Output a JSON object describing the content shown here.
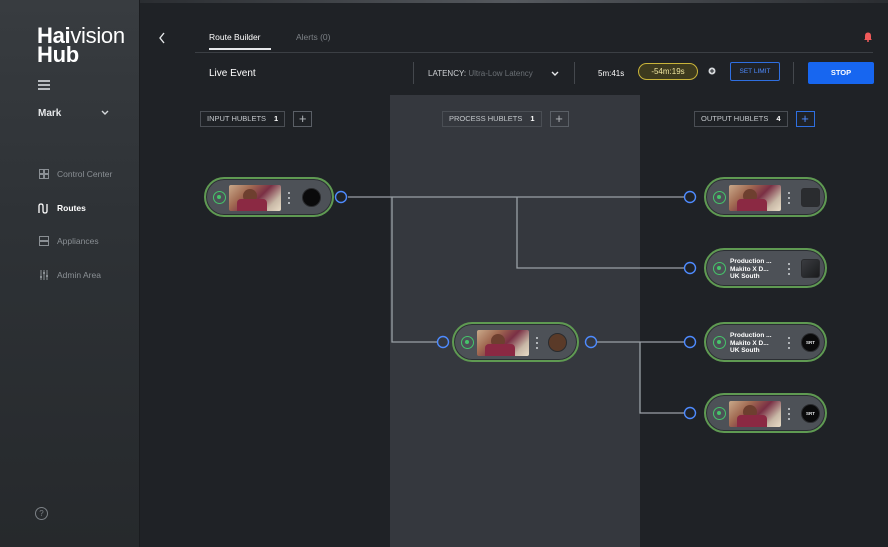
{
  "brand": {
    "line1_bold": "Hai",
    "line1_rest": "vision",
    "line2": "Hub"
  },
  "sidebar": {
    "user": "Mark",
    "items": [
      {
        "label": "Control Center",
        "icon": "grid-icon",
        "active": false
      },
      {
        "label": "Routes",
        "icon": "route-icon",
        "active": true
      },
      {
        "label": "Appliances",
        "icon": "appliance-icon",
        "active": false
      },
      {
        "label": "Admin Area",
        "icon": "sliders-icon",
        "active": false
      }
    ],
    "help": "?"
  },
  "header": {
    "tabs": [
      {
        "label": "Route Builder",
        "active": true
      },
      {
        "label": "Alerts (0)",
        "active": false
      }
    ],
    "event_name": "Live Event",
    "latency_label": "LATENCY:",
    "latency_value": "Ultra-Low Latency",
    "elapsed": "5m:41s",
    "remaining": "-54m:19s",
    "set_limit": "SET LIMIT",
    "stop": "STOP"
  },
  "columns": {
    "input": {
      "label": "INPUT HUBLETS",
      "count": "1"
    },
    "process": {
      "label": "PROCESS HUBLETS",
      "count": "1"
    },
    "output": {
      "label": "OUTPUT HUBLETS",
      "count": "4"
    }
  },
  "nodes": {
    "input1": {
      "badge": ""
    },
    "process1": {
      "badge": ""
    },
    "out1": {
      "badge": ""
    },
    "out2": {
      "title": "Production ...",
      "device": "Makito X D...",
      "region": "UK South"
    },
    "out3": {
      "title": "Production ...",
      "device": "Makito X D...",
      "region": "UK South",
      "badge": "SRT"
    },
    "out4": {
      "badge": "SRT"
    }
  },
  "colors": {
    "accent": "#1766f0",
    "status_ok": "#46c46a",
    "node_border": "#5f9a52",
    "connector": "#4e8bff",
    "timer_pill": "#c9b43a"
  }
}
